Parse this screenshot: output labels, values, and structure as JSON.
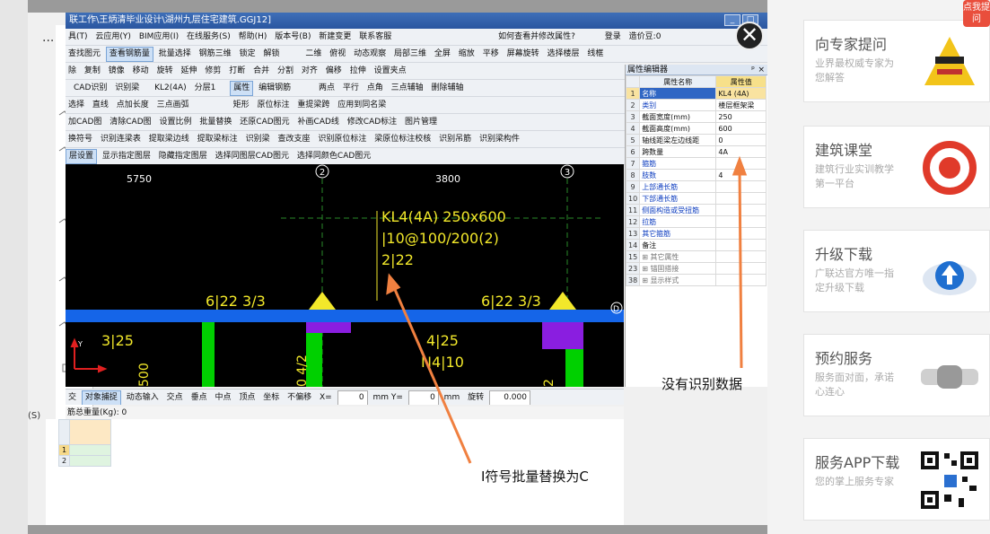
{
  "window": {
    "title": "联工作\\王炳清毕业设计\\湖州九层住宅建筑.GGJ12]",
    "minimize": "_",
    "maximize": "□",
    "close": "×"
  },
  "menu": [
    "具(T)",
    "云应用(Y)",
    "BIM应用(I)",
    "在线服务(S)",
    "帮助(H)",
    "版本号(B)",
    "新建变更",
    "联系客服",
    "如何查看并修改属性?",
    "登录",
    "造价豆:0"
  ],
  "toolbar1": [
    "查找图元",
    "查看钢筋量",
    "批量选择",
    "钢筋三维",
    "锁定",
    "解锁",
    "二维",
    "俯视",
    "动态观察",
    "局部三维",
    "全屏",
    "缩放",
    "平移",
    "屏幕旋转",
    "选择楼层",
    "线框"
  ],
  "toolbar2": [
    "除",
    "复制",
    "镜像",
    "移动",
    "旋转",
    "延伸",
    "修剪",
    "打断",
    "合并",
    "分割",
    "对齐",
    "偏移",
    "拉伸",
    "设置夹点"
  ],
  "toolbar3": [
    "CAD识别",
    "识别梁",
    "KL2(4A)",
    "分层1",
    "属性",
    "编辑钢筋",
    "两点",
    "平行",
    "点角",
    "三点辅轴",
    "删除辅轴"
  ],
  "toolbar4": [
    "选择",
    "直线",
    "点加长度",
    "三点画弧",
    "矩形",
    "原位标注",
    "重提梁跨",
    "应用到同名梁"
  ],
  "toolbar5": [
    "加CAD图",
    "清除CAD图",
    "设置比例",
    "批量替换",
    "还原CAD图元",
    "补画CAD线",
    "修改CAD标注",
    "图片管理"
  ],
  "toolbar6": [
    "换符号",
    "识别连梁表",
    "提取梁边线",
    "提取梁标注",
    "识别梁",
    "查改支座",
    "识别原位标注",
    "梁原位标注校核",
    "识别吊筋",
    "识别梁构件"
  ],
  "toolbar7": [
    "层设置",
    "显示指定图层",
    "隐藏指定图层",
    "选择同图层CAD图元",
    "选择同颜色CAD图元"
  ],
  "canvas": {
    "dim_left": "5750",
    "dim_right": "3800",
    "axis_2": "2",
    "axis_3": "3",
    "beam_label_1": "KL4(4A) 250x600",
    "beam_label_2": "|10@100/200(2)",
    "beam_label_3": "2|22",
    "top_rebar_left": "6|22 3/3",
    "top_rebar_right": "6|22 3/3",
    "bottom_left": "3|25",
    "bottom_mid_1": "4|25",
    "bottom_mid_2": "N4|10",
    "vertical_1": "0 4/2",
    "vertical_2": "500",
    "vertical_3": "2",
    "d_marker": "D",
    "axis_y": "Y"
  },
  "properties": {
    "title": "属性编辑器",
    "pin": "ᵖ",
    "close": "×",
    "col_name": "属性名称",
    "col_value": "属性值",
    "rows": [
      {
        "n": "1",
        "name": "名称",
        "value": "KL4 (4A)",
        "blue": true
      },
      {
        "n": "2",
        "name": "类别",
        "value": "楼层框架梁",
        "blue": true
      },
      {
        "n": "3",
        "name": "截面宽度(mm)",
        "value": "250",
        "blue": false
      },
      {
        "n": "4",
        "name": "截面高度(mm)",
        "value": "600",
        "blue": false
      },
      {
        "n": "5",
        "name": "轴线距梁左边线距",
        "value": "0",
        "blue": false
      },
      {
        "n": "6",
        "name": "跨数量",
        "value": "4A",
        "blue": false
      },
      {
        "n": "7",
        "name": "箍筋",
        "value": "",
        "blue": true
      },
      {
        "n": "8",
        "name": "肢数",
        "value": "4",
        "blue": true
      },
      {
        "n": "9",
        "name": "上部通长筋",
        "value": "",
        "blue": true
      },
      {
        "n": "10",
        "name": "下部通长筋",
        "value": "",
        "blue": true
      },
      {
        "n": "11",
        "name": "侧面构造或受扭筋",
        "value": "",
        "blue": true
      },
      {
        "n": "12",
        "name": "拉筋",
        "value": "",
        "blue": true
      },
      {
        "n": "13",
        "name": "其它箍筋",
        "value": "",
        "blue": true
      },
      {
        "n": "14",
        "name": "备注",
        "value": "",
        "blue": false
      },
      {
        "n": "15",
        "name": "其它属性",
        "value": "",
        "blue": false,
        "group": true
      },
      {
        "n": "23",
        "name": "锚固搭接",
        "value": "",
        "blue": false,
        "group": true
      },
      {
        "n": "38",
        "name": "显示样式",
        "value": "",
        "blue": false,
        "group": true
      }
    ]
  },
  "status_bar": [
    "交",
    "对象捕捉",
    "动态输入",
    "交点",
    "垂点",
    "中点",
    "顶点",
    "坐标",
    "不偏移",
    "X=",
    "0",
    "mm Y=",
    "0",
    "mm",
    "旋转",
    "0.000"
  ],
  "rebar_total": "筋总重量(Kg): 0",
  "grid_rows": [
    "1",
    "2"
  ],
  "annotations": {
    "right": "没有识别数据",
    "bottom": "I符号批量替换为C"
  },
  "left": {
    "dots": "...",
    "s_label": "(S)"
  },
  "ads": [
    {
      "title": "向专家提问",
      "desc": "业界最权威专家为您解答"
    },
    {
      "title": "建筑课堂",
      "desc": "建筑行业实训教学第一平台"
    },
    {
      "title": "升级下载",
      "desc": "广联达官方唯一指定升级下载"
    },
    {
      "title": "预约服务",
      "desc": "服务面对面，承诺心连心"
    },
    {
      "title": "服务APP下载",
      "desc": "您的掌上服务专家"
    }
  ],
  "ad_badge": "点我提问",
  "close_overlay": "✕",
  "colors": {
    "beam_blue": "#1565e8",
    "annotation_text": "#f2e82a",
    "green_rebar": "#00d000",
    "purple": "#8a1ee0",
    "arrow_orange": "#f08040"
  }
}
